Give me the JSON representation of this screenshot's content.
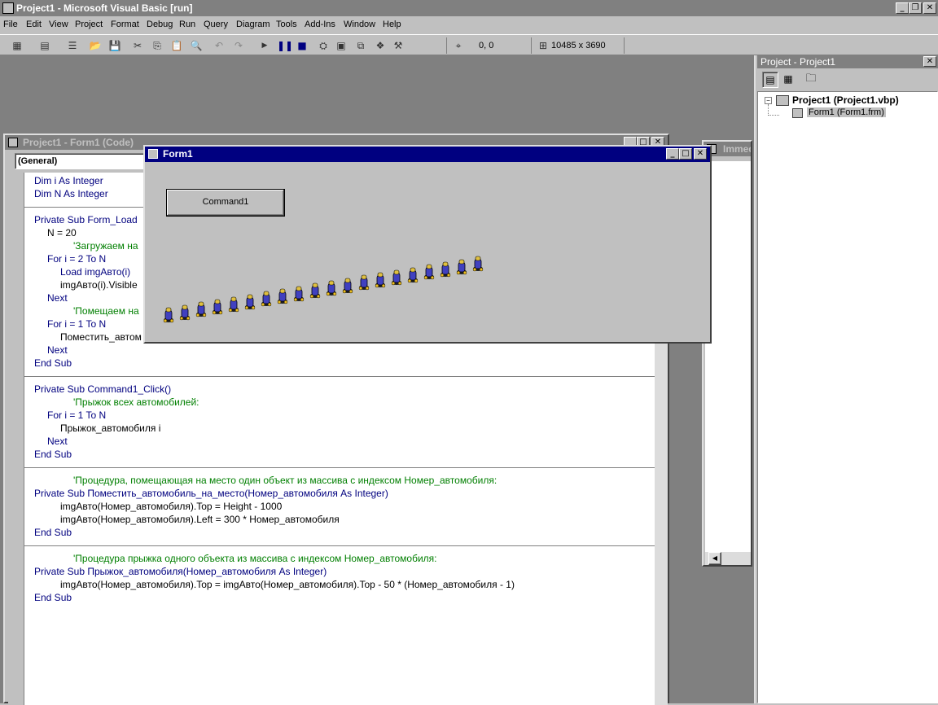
{
  "app": {
    "title": "Project1 - Microsoft Visual Basic [run]"
  },
  "menu": [
    "File",
    "Edit",
    "View",
    "Project",
    "Format",
    "Debug",
    "Run",
    "Query",
    "Diagram",
    "Tools",
    "Add-Ins",
    "Window",
    "Help"
  ],
  "toolbar": {
    "coords": "0, 0",
    "size": "10485 x 3690"
  },
  "code_window": {
    "title": "Project1 - Form1 (Code)",
    "combo": "(General)",
    "lines": [
      {
        "t": "Dim i As Integer",
        "k": "kw",
        "i": 0
      },
      {
        "t": "Dim N As Integer",
        "k": "kw",
        "i": 0
      },
      {
        "t": "",
        "k": "sep",
        "i": 0
      },
      {
        "t": "Private Sub Form_Load",
        "k": "kw",
        "i": 0
      },
      {
        "t": "N = 20",
        "k": "",
        "i": 1
      },
      {
        "t": "'Загружаем на",
        "k": "cm",
        "i": 3
      },
      {
        "t": "For i = 2 To N",
        "k": "kw",
        "i": 1
      },
      {
        "t": "Load imgАвто(i)",
        "k": "kw",
        "i": 2
      },
      {
        "t": "imgАвто(i).Visible",
        "k": "",
        "i": 2
      },
      {
        "t": "Next",
        "k": "kw",
        "i": 1
      },
      {
        "t": "'Помещаем на",
        "k": "cm",
        "i": 3
      },
      {
        "t": "For i = 1 To N",
        "k": "kw",
        "i": 1
      },
      {
        "t": "Поместить_автом",
        "k": "",
        "i": 2
      },
      {
        "t": "Next",
        "k": "kw",
        "i": 1
      },
      {
        "t": "End Sub",
        "k": "kw",
        "i": 0
      },
      {
        "t": "",
        "k": "sep",
        "i": 0
      },
      {
        "t": "Private Sub Command1_Click()",
        "k": "kw",
        "i": 0
      },
      {
        "t": "'Прыжок всех автомобилей:",
        "k": "cm",
        "i": 3
      },
      {
        "t": "For i = 1 To N",
        "k": "kw",
        "i": 1
      },
      {
        "t": "Прыжок_автомобиля i",
        "k": "",
        "i": 2
      },
      {
        "t": "Next",
        "k": "kw",
        "i": 1
      },
      {
        "t": "End Sub",
        "k": "kw",
        "i": 0
      },
      {
        "t": "",
        "k": "sep",
        "i": 0
      },
      {
        "t": "'Процедура, помещающая на место один объект из массива с индексом Номер_автомобиля:",
        "k": "cm",
        "i": 3
      },
      {
        "t": "Private Sub Поместить_автомобиль_на_место(Номер_автомобиля As Integer)",
        "k": "kw",
        "i": 0
      },
      {
        "t": "imgАвто(Номер_автомобиля).Top = Height - 1000",
        "k": "",
        "i": 2
      },
      {
        "t": "imgАвто(Номер_автомобиля).Left = 300 * Номер_автомобиля",
        "k": "",
        "i": 2
      },
      {
        "t": "End Sub",
        "k": "kw",
        "i": 0
      },
      {
        "t": "",
        "k": "sep",
        "i": 0
      },
      {
        "t": "'Процедура прыжка одного объекта из массива с индексом Номер_автомобиля:",
        "k": "cm",
        "i": 3
      },
      {
        "t": "Private Sub Прыжок_автомобиля(Номер_автомобиля As Integer)",
        "k": "kw",
        "i": 0
      },
      {
        "t": "imgАвто(Номер_автомобиля).Top = imgАвто(Номер_автомобиля).Top - 50 * (Номер_автомобиля - 1)",
        "k": "",
        "i": 2
      },
      {
        "t": "End Sub",
        "k": "kw",
        "i": 0
      }
    ]
  },
  "immediate": {
    "title": "Immed"
  },
  "form1": {
    "title": "Form1",
    "button": "Command1",
    "car_count": 20
  },
  "project": {
    "title": "Project - Project1",
    "root": "Project1 (Project1.vbp)",
    "child": "Form1 (Form1.frm)"
  }
}
